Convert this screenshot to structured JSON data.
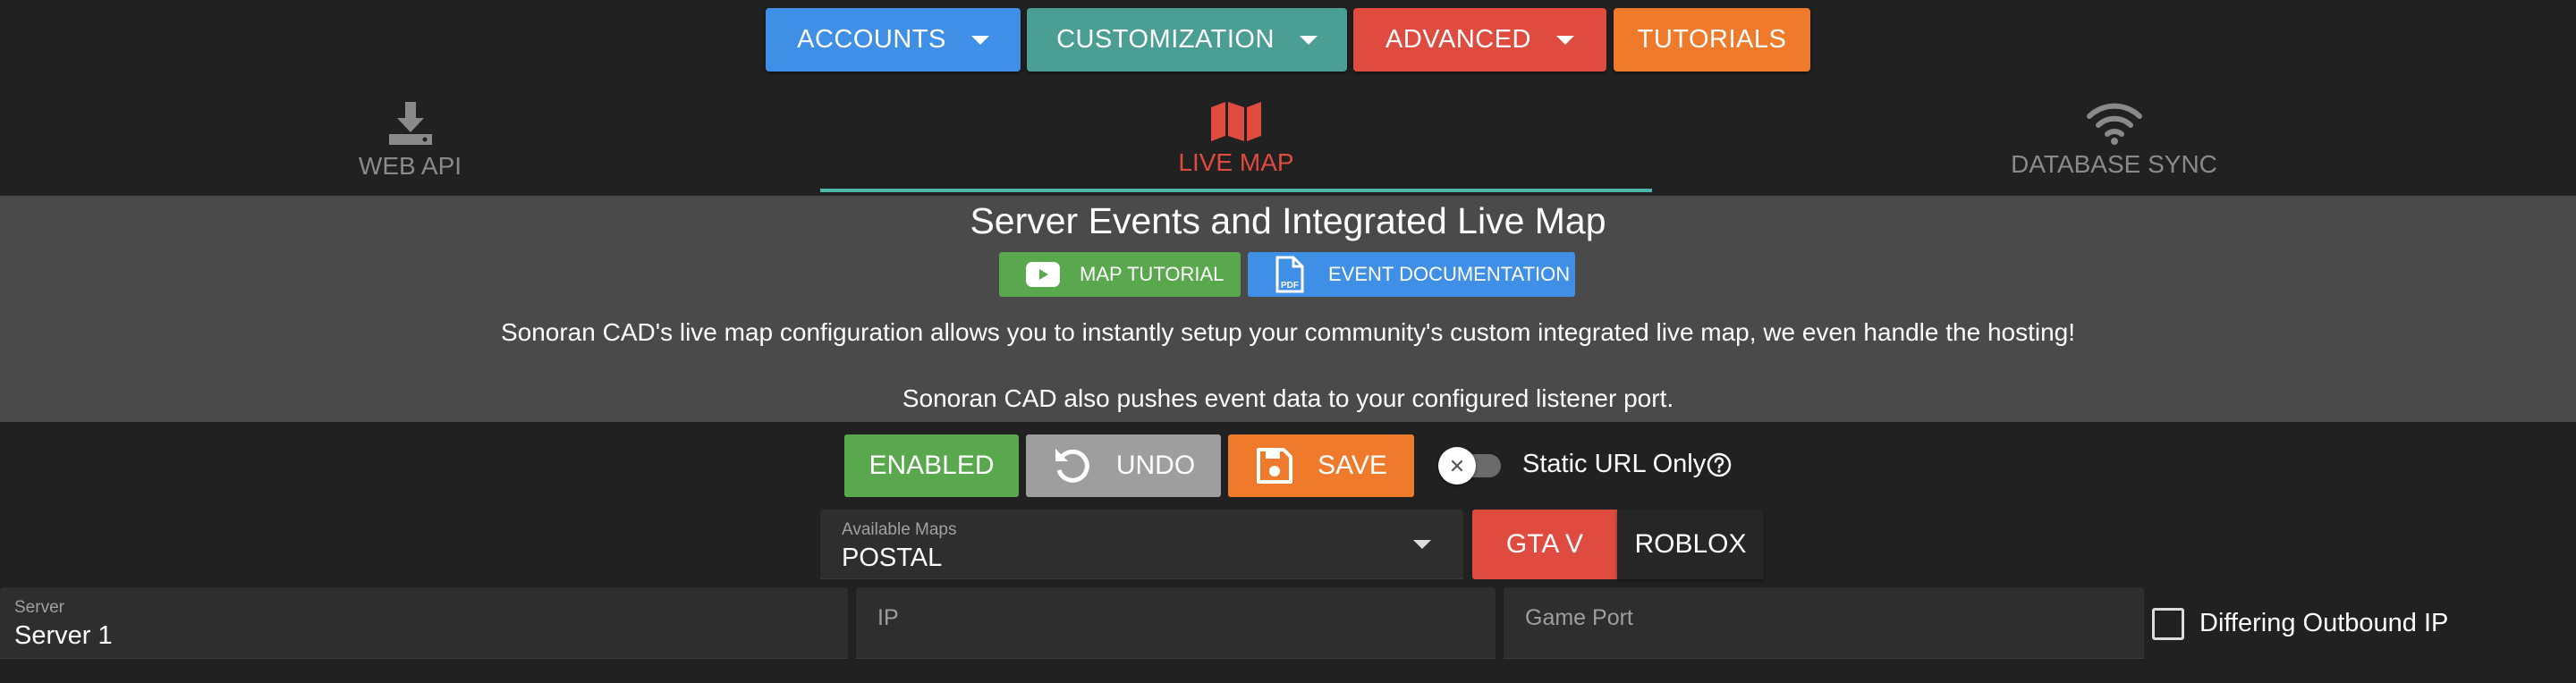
{
  "menu": {
    "accounts": "ACCOUNTS",
    "customization": "CUSTOMIZATION",
    "advanced": "ADVANCED",
    "tutorials": "TUTORIALS"
  },
  "tabs": [
    {
      "label": "WEB API",
      "icon": "download-icon",
      "active": false
    },
    {
      "label": "LIVE MAP",
      "icon": "map-icon",
      "active": true
    },
    {
      "label": "DATABASE SYNC",
      "icon": "wifi-icon",
      "active": false
    }
  ],
  "header": {
    "title": "Server Events and Integrated Live Map",
    "map_tutorial": "MAP TUTORIAL",
    "event_docs": "EVENT DOCUMENTATION",
    "pdf_badge": "PDF",
    "desc1": "Sonoran CAD's live map configuration allows you to instantly setup your community's custom integrated live map, we even handle the hosting!",
    "desc2": "Sonoran CAD also pushes event data to your configured listener port."
  },
  "actions": {
    "enabled": "ENABLED",
    "undo": "UNDO",
    "save": "SAVE",
    "static_url": "Static URL Only",
    "static_url_on": false
  },
  "maps": {
    "label": "Available Maps",
    "value": "POSTAL",
    "options": [
      "GTA V",
      "ROBLOX"
    ],
    "selected": "GTA V"
  },
  "server": {
    "server_label": "Server",
    "server_value": "Server 1",
    "ip_placeholder": "IP",
    "port_placeholder": "Game Port",
    "outbound_label": "Differing Outbound IP",
    "outbound_checked": false
  },
  "colors": {
    "blue": "#3f8fe6",
    "teal": "#4a9e94",
    "red": "#e04b3f",
    "orange": "#ef7a2b",
    "green": "#5aa84e",
    "grey": "#9e9e9e",
    "accent": "#4db6ac"
  }
}
